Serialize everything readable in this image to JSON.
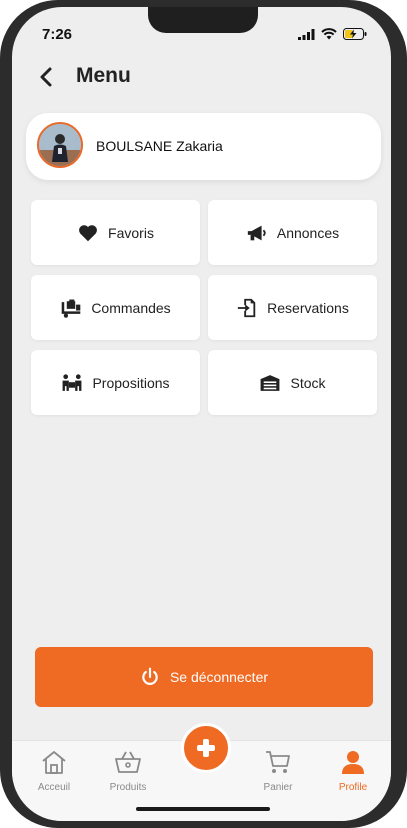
{
  "status_bar": {
    "time": "7:26"
  },
  "header": {
    "title": "Menu"
  },
  "profile": {
    "name": "BOULSANE Zakaria"
  },
  "menu": {
    "items": [
      {
        "label": "Favoris",
        "icon": "heart-icon"
      },
      {
        "label": "Annonces",
        "icon": "megaphone-icon"
      },
      {
        "label": "Commandes",
        "icon": "delivery-icon"
      },
      {
        "label": "Reservations",
        "icon": "sign-in-icon"
      },
      {
        "label": "Propositions",
        "icon": "people-carry-icon"
      },
      {
        "label": "Stock",
        "icon": "warehouse-icon"
      }
    ]
  },
  "logout": {
    "label": "Se déconnecter"
  },
  "tabbar": {
    "tabs": [
      {
        "label": "Acceuil",
        "icon": "home-icon"
      },
      {
        "label": "Produits",
        "icon": "basket-icon"
      },
      {
        "label": "",
        "icon": "plus-icon"
      },
      {
        "label": "Panier",
        "icon": "cart-icon"
      },
      {
        "label": "Profile",
        "icon": "user-icon",
        "active": true
      }
    ]
  },
  "colors": {
    "accent": "#ef6a22",
    "background": "#eeeeee",
    "card": "#ffffff"
  }
}
